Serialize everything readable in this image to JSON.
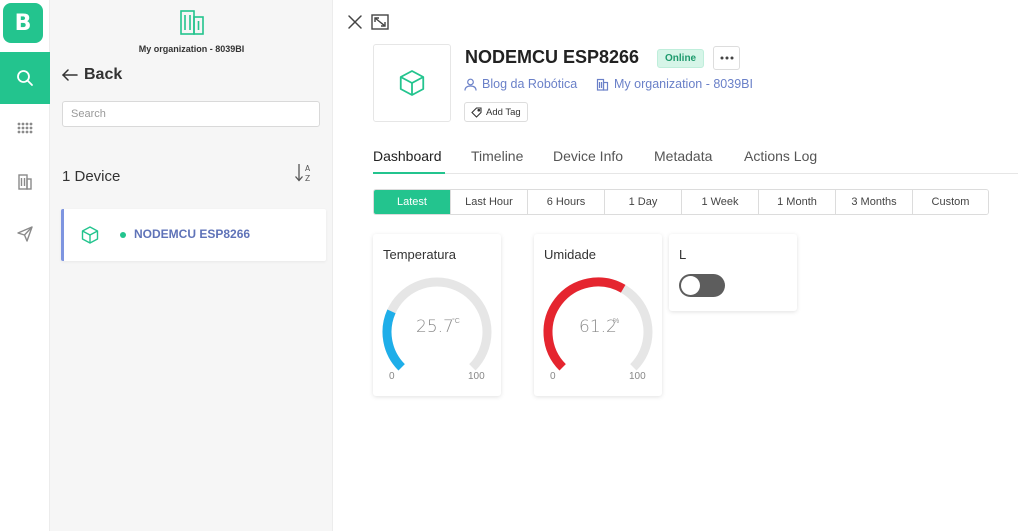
{
  "app": {
    "logo_letter": "B"
  },
  "rail": {
    "items": [
      {
        "name": "search",
        "active": true
      },
      {
        "name": "apps",
        "active": false
      },
      {
        "name": "organization",
        "active": false
      },
      {
        "name": "send",
        "active": false
      }
    ]
  },
  "panel": {
    "org_name": "My organization - 8039BI",
    "back_label": "Back",
    "search_placeholder": "Search",
    "device_count": "1 Device",
    "devices": [
      {
        "name": "NODEMCU ESP8266",
        "status": "online"
      }
    ]
  },
  "device": {
    "title": "NODEMCU ESP8266",
    "status": "Online",
    "owner": "Blog da Robótica",
    "organization": "My organization - 8039BI",
    "add_tag": "Add Tag"
  },
  "tabs": [
    "Dashboard",
    "Timeline",
    "Device Info",
    "Metadata",
    "Actions Log"
  ],
  "active_tab": "Dashboard",
  "ranges": [
    "Latest",
    "Last Hour",
    "6 Hours",
    "1 Day",
    "1 Week",
    "1 Month",
    "3 Months",
    "Custom"
  ],
  "active_range": "Latest",
  "widgets": {
    "temperatura": {
      "title": "Temperatura",
      "value": "25.7",
      "unit": "°C",
      "min": "0",
      "max": "100",
      "fraction": 0.257,
      "color": "#1eaee9"
    },
    "umidade": {
      "title": "Umidade",
      "value": "61.2",
      "unit": "%",
      "min": "0",
      "max": "100",
      "fraction": 0.612,
      "color": "#e5252f"
    },
    "switch": {
      "title": "L",
      "on": false
    }
  },
  "colors": {
    "brand": "#23c48e",
    "link": "#6a80c8",
    "track": "#e6e6e6"
  }
}
